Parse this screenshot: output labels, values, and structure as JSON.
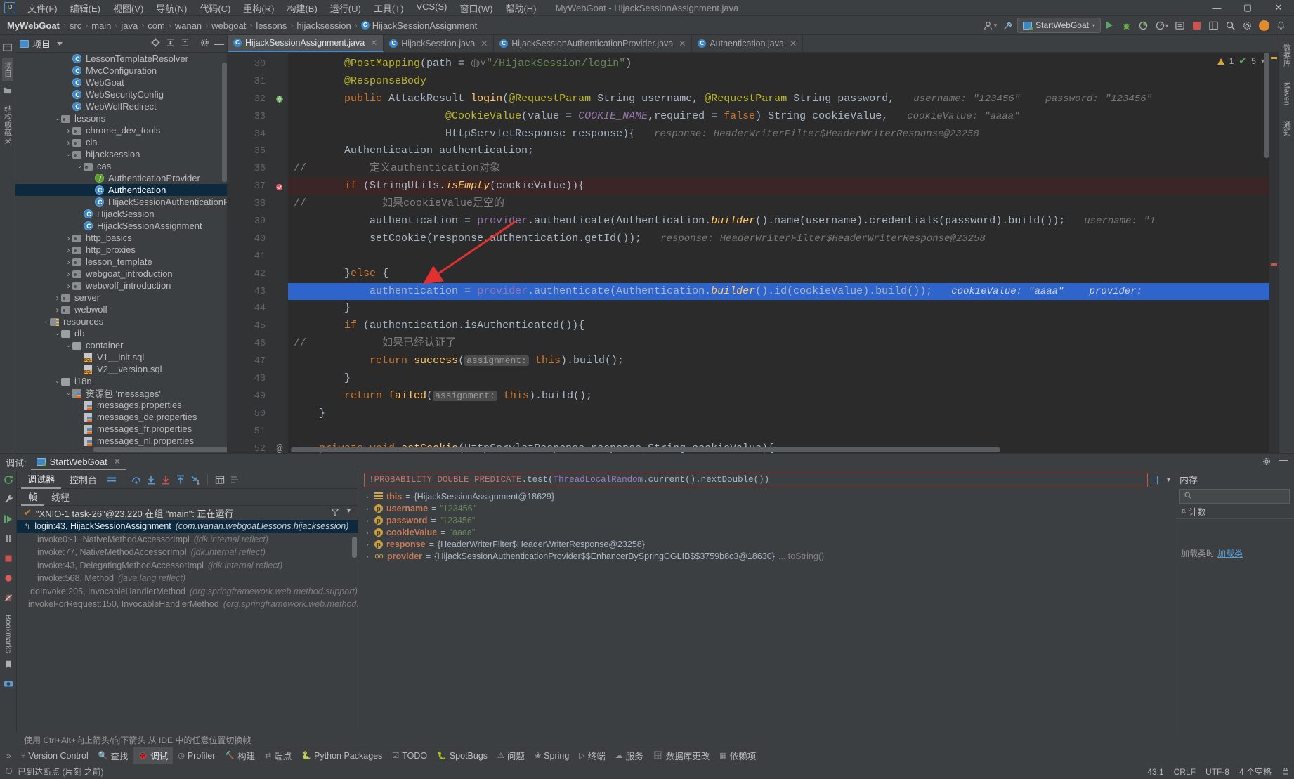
{
  "window": {
    "title": "MyWebGoat - HijackSessionAssignment.java",
    "minimize": "—",
    "maximize": "▢",
    "close": "✕"
  },
  "menubar": {
    "items": [
      "文件(F)",
      "编辑(E)",
      "视图(V)",
      "导航(N)",
      "代码(C)",
      "重构(R)",
      "构建(B)",
      "运行(U)",
      "工具(T)",
      "VCS(S)",
      "窗口(W)",
      "帮助(H)"
    ]
  },
  "breadcrumb": {
    "items": [
      "MyWebGoat",
      "src",
      "main",
      "java",
      "com",
      "wanan",
      "webgoat",
      "lessons",
      "hijacksession",
      "HijackSessionAssignment"
    ],
    "separator": "›"
  },
  "toolbar": {
    "run_config": "StartWebGoat",
    "run_tooltip": "运行",
    "debug_tooltip": "调试",
    "stop_tooltip": "停止",
    "search_tooltip": "搜索",
    "settings_tooltip": "设置",
    "icons": [
      "user-icon",
      "hammer-icon",
      "run-icon",
      "debug-icon",
      "profile-icon",
      "coverage-icon",
      "stop-icon",
      "update-icon",
      "search-icon",
      "settings-icon",
      "account-icon",
      "notification-icon"
    ]
  },
  "left_strip": {
    "labels": [
      "项目",
      "结构收藏夹"
    ]
  },
  "right_strip": {
    "labels": [
      "数据库",
      "Maven",
      "通知"
    ]
  },
  "project_panel": {
    "title": "项目",
    "tree": [
      {
        "indent": 4,
        "arrow": "",
        "icon": "class",
        "label": "LessonTemplateResolver"
      },
      {
        "indent": 4,
        "arrow": "",
        "icon": "class",
        "label": "MvcConfiguration"
      },
      {
        "indent": 4,
        "arrow": "",
        "icon": "class",
        "label": "WebGoat"
      },
      {
        "indent": 4,
        "arrow": "",
        "icon": "class",
        "label": "WebSecurityConfig"
      },
      {
        "indent": 4,
        "arrow": "",
        "icon": "class",
        "label": "WebWolfRedirect"
      },
      {
        "indent": 3,
        "arrow": "v",
        "icon": "pkg",
        "label": "lessons"
      },
      {
        "indent": 4,
        "arrow": ">",
        "icon": "pkg",
        "label": "chrome_dev_tools"
      },
      {
        "indent": 4,
        "arrow": ">",
        "icon": "pkg",
        "label": "cia"
      },
      {
        "indent": 4,
        "arrow": "v",
        "icon": "pkg",
        "label": "hijacksession"
      },
      {
        "indent": 5,
        "arrow": "v",
        "icon": "pkg",
        "label": "cas"
      },
      {
        "indent": 6,
        "arrow": "",
        "icon": "iface",
        "label": "AuthenticationProvider"
      },
      {
        "indent": 6,
        "arrow": "",
        "icon": "class",
        "label": "Authentication",
        "selected": true
      },
      {
        "indent": 6,
        "arrow": "",
        "icon": "class",
        "label": "HijackSessionAuthenticationProvider"
      },
      {
        "indent": 5,
        "arrow": "",
        "icon": "class",
        "label": "HijackSession"
      },
      {
        "indent": 5,
        "arrow": "",
        "icon": "class",
        "label": "HijackSessionAssignment"
      },
      {
        "indent": 4,
        "arrow": ">",
        "icon": "pkg",
        "label": "http_basics"
      },
      {
        "indent": 4,
        "arrow": ">",
        "icon": "pkg",
        "label": "http_proxies"
      },
      {
        "indent": 4,
        "arrow": ">",
        "icon": "pkg",
        "label": "lesson_template"
      },
      {
        "indent": 4,
        "arrow": ">",
        "icon": "pkg",
        "label": "webgoat_introduction"
      },
      {
        "indent": 4,
        "arrow": ">",
        "icon": "pkg",
        "label": "webwolf_introduction"
      },
      {
        "indent": 3,
        "arrow": ">",
        "icon": "pkg",
        "label": "server"
      },
      {
        "indent": 3,
        "arrow": ">",
        "icon": "pkg",
        "label": "webwolf"
      },
      {
        "indent": 2,
        "arrow": "v",
        "icon": "resources",
        "label": "resources"
      },
      {
        "indent": 3,
        "arrow": "v",
        "icon": "folder",
        "label": "db"
      },
      {
        "indent": 4,
        "arrow": "v",
        "icon": "folder",
        "label": "container"
      },
      {
        "indent": 5,
        "arrow": "",
        "icon": "sql",
        "label": "V1__init.sql"
      },
      {
        "indent": 5,
        "arrow": "",
        "icon": "sql",
        "label": "V2__version.sql"
      },
      {
        "indent": 3,
        "arrow": "v",
        "icon": "folder",
        "label": "i18n"
      },
      {
        "indent": 4,
        "arrow": "v",
        "icon": "resbundle",
        "label": "资源包 'messages'"
      },
      {
        "indent": 5,
        "arrow": "",
        "icon": "prop",
        "label": "messages.properties"
      },
      {
        "indent": 5,
        "arrow": "",
        "icon": "prop",
        "label": "messages_de.properties"
      },
      {
        "indent": 5,
        "arrow": "",
        "icon": "prop",
        "label": "messages_fr.properties"
      },
      {
        "indent": 5,
        "arrow": "",
        "icon": "prop",
        "label": "messages_nl.properties"
      }
    ]
  },
  "editor": {
    "tabs": [
      {
        "label": "HijackSessionAssignment.java",
        "active": true
      },
      {
        "label": "HijackSession.java",
        "active": false
      },
      {
        "label": "HijackSessionAuthenticationProvider.java",
        "active": false
      },
      {
        "label": "Authentication.java",
        "active": false
      }
    ],
    "inspection": {
      "warnings": "1",
      "checks": "5"
    },
    "first_line_number": 30,
    "lines": [
      {
        "n": 30,
        "gutter": "",
        "html": "        <span class='anno'>@PostMapping</span><span class='id'>(path = </span><span class='cm'>◍˅</span><span class='str'>\"</span><span class='ulink'>/HijackSession/login</span><span class='str'>\"</span><span class='id'>)</span>"
      },
      {
        "n": 31,
        "gutter": "",
        "html": "        <span class='anno'>@ResponseBody</span>"
      },
      {
        "n": 32,
        "gutter": "globe",
        "html": "        <span class='k'>public</span> <span class='id'>AttackResult</span> <span class='fn'>login</span><span class='id'>(</span><span class='anno'>@RequestParam</span> <span class='id'>String username, </span><span class='anno'>@RequestParam</span> <span class='id'>String password,</span>   <span class='hint'>username:</span> <span class='hint'>\"123456\"</span>    <span class='hint'>password:</span> <span class='hint'>\"123456\"</span>"
      },
      {
        "n": 33,
        "gutter": "",
        "html": "                        <span class='anno'>@CookieValue</span><span class='id'>(value = </span><span class='fld ital'>COOKIE_NAME</span><span class='id'>,required = </span><span class='k'>false</span><span class='id'>) String cookieValue,</span>   <span class='hint'>cookieValue:</span> <span class='hint'>\"aaaa\"</span>"
      },
      {
        "n": 34,
        "gutter": "",
        "html": "                        <span class='id'>HttpServletResponse response){</span>   <span class='hint'>response:</span> <span class='hint'>HeaderWriterFilter$HeaderWriterResponse@23258</span>"
      },
      {
        "n": 35,
        "gutter": "",
        "html": "        <span class='id'>Authentication authentication;</span>"
      },
      {
        "n": 36,
        "gutter": "",
        "comment_col": "//",
        "html": "            <span class='cm'>定义authentication对象</span>"
      },
      {
        "n": 37,
        "gutter": "breakpoint",
        "bp": true,
        "html": "        <span class='k'>if</span> <span class='id'>(StringUtils.</span><span class='fn ital'>isEmpty</span><span class='id'>(cookieValue)){</span>"
      },
      {
        "n": 38,
        "gutter": "",
        "comment_col": "//",
        "html": "              <span class='cm'>如果cookieValue是空的</span>"
      },
      {
        "n": 39,
        "gutter": "",
        "html": "            <span class='id'>authentication = </span><span class='fld'>provider</span><span class='id'>.authenticate(Authentication.</span><span class='fn ital'>builder</span><span class='id'>().name(username).credentials(password).build());</span>   <span class='hint'>username:</span> <span class='hint'>\"1</span>"
      },
      {
        "n": 40,
        "gutter": "",
        "html": "            <span class='id'>setCookie(response,authentication.getId());</span>   <span class='hint'>response:</span> <span class='hint'>HeaderWriterFilter$HeaderWriterResponse@23258</span>"
      },
      {
        "n": 41,
        "gutter": "",
        "html": ""
      },
      {
        "n": 42,
        "gutter": "",
        "html": "        <span class='id'>}</span><span class='k'>else</span> <span class='id'>{</span>"
      },
      {
        "n": 43,
        "gutter": "",
        "current": true,
        "html": "            <span class='id'>authentication = </span><span class='fld'>provider</span><span class='id'>.authenticate(Authentication.</span><span class='fn ital'>builder</span><span class='id'>().id(cookieValue).build());</span>   <span class='hint'>cookieValue:</span> <span class='hint'>\"aaaa\"</span>    <span class='hint'>provider:</span>"
      },
      {
        "n": 44,
        "gutter": "",
        "html": "        <span class='id'>}</span>"
      },
      {
        "n": 45,
        "gutter": "",
        "html": "        <span class='k'>if</span> <span class='id'>(authentication.isAuthenticated()){</span>"
      },
      {
        "n": 46,
        "gutter": "",
        "comment_col": "//",
        "html": "              <span class='cm'>如果已经认证了</span>"
      },
      {
        "n": 47,
        "gutter": "",
        "html": "            <span class='k'>return</span> <span class='fn'>success</span><span class='id'>(</span><span class='hintblk'>assignment:</span> <span class='k'>this</span><span class='id'>).build();</span>"
      },
      {
        "n": 48,
        "gutter": "",
        "html": "        <span class='id'>}</span>"
      },
      {
        "n": 49,
        "gutter": "",
        "html": "        <span class='k'>return</span> <span class='fn'>failed</span><span class='id'>(</span><span class='hintblk'>assignment:</span> <span class='k'>this</span><span class='id'>).build();</span>"
      },
      {
        "n": 50,
        "gutter": "",
        "html": "    <span class='id'>}</span>"
      },
      {
        "n": 51,
        "gutter": "",
        "html": ""
      },
      {
        "n": 52,
        "gutter": "at",
        "html": "    <span class='k'>private</span> <span class='k'>void</span> <span class='fn'>setCookie</span><span class='id'>(HttpServletResponse response,String cookieValue){</span>"
      }
    ]
  },
  "debug": {
    "label": "调试:",
    "session_tab": "StartWebGoat",
    "tabs": [
      "调试器",
      "控制台"
    ],
    "active_tab": "调试器",
    "frame_tabs": [
      "帧",
      "线程"
    ],
    "active_frame_tab": "帧",
    "thread_line": "\"XNIO-1 task-26\"@23,220 在组 \"main\": 正在运行",
    "frames": [
      {
        "text": "login:43, HijackSessionAssignment ",
        "pkg": "(com.wanan.webgoat.lessons.hijacksession)",
        "selected": true
      },
      {
        "text": "invoke0:-1, NativeMethodAccessorImpl ",
        "pkg": "(jdk.internal.reflect)"
      },
      {
        "text": "invoke:77, NativeMethodAccessorImpl ",
        "pkg": "(jdk.internal.reflect)"
      },
      {
        "text": "invoke:43, DelegatingMethodAccessorImpl ",
        "pkg": "(jdk.internal.reflect)"
      },
      {
        "text": "invoke:568, Method ",
        "pkg": "(java.lang.reflect)"
      },
      {
        "text": "doInvoke:205, InvocableHandlerMethod ",
        "pkg": "(org.springframework.web.method.support)"
      },
      {
        "text": "invokeForRequest:150, InvocableHandlerMethod ",
        "pkg": "(org.springframework.web.method.supp"
      }
    ],
    "watch_expression": {
      "prefix": "!",
      "constant": "PROBABILITY_DOUBLE_PREDICATE",
      "mid": ".test(",
      "cls": "ThreadLocalRandom",
      "suffix": ".current().nextDouble())"
    },
    "variables": [
      {
        "icon": "this",
        "name": "this",
        "eq": "=",
        "value": "{HijackSessionAssignment@18629}",
        "kind": "obj"
      },
      {
        "icon": "p",
        "name": "username",
        "eq": "=",
        "value": "\"123456\"",
        "kind": "str"
      },
      {
        "icon": "p",
        "name": "password",
        "eq": "=",
        "value": "\"123456\"",
        "kind": "str"
      },
      {
        "icon": "p",
        "name": "cookieValue",
        "eq": "=",
        "value": "\"aaaa\"",
        "kind": "str"
      },
      {
        "icon": "p",
        "name": "response",
        "eq": "=",
        "value": "{HeaderWriterFilter$HeaderWriterResponse@23258}",
        "kind": "obj"
      },
      {
        "icon": "oo",
        "name": "provider",
        "eq": "=",
        "value": "{HijackSessionAuthenticationProvider$$EnhancerBySpringCGLIB$$3759b8c3@18630}",
        "extra": "... toString()",
        "kind": "obj"
      }
    ],
    "memory": {
      "title": "内存",
      "search_placeholder": "",
      "column": "计数",
      "message": "加载类时",
      "link": "加载类"
    },
    "hint": "使用 Ctrl+Alt+向上箭头/向下箭头 从 IDE 中的任意位置切换帧",
    "vstrip_label": "Bookmarks"
  },
  "bottom_bar": {
    "chevron": "»",
    "items": [
      {
        "label": "Version Control",
        "icon": "branch-icon"
      },
      {
        "label": "查找",
        "icon": "find-icon"
      },
      {
        "label": "调试",
        "icon": "debug-icon",
        "active": true
      },
      {
        "label": "Profiler",
        "icon": "profiler-icon"
      },
      {
        "label": "构建",
        "icon": "build-icon"
      },
      {
        "label": "端点",
        "icon": "endpoints-icon"
      },
      {
        "label": "Python Packages",
        "icon": "python-icon"
      },
      {
        "label": "TODO",
        "icon": "todo-icon"
      },
      {
        "label": "SpotBugs",
        "icon": "spotbugs-icon"
      },
      {
        "label": "问题",
        "icon": "problems-icon"
      },
      {
        "label": "Spring",
        "icon": "spring-icon"
      },
      {
        "label": "终端",
        "icon": "terminal-icon"
      },
      {
        "label": "服务",
        "icon": "services-icon"
      },
      {
        "label": "数据库更改",
        "icon": "db-icon"
      },
      {
        "label": "依赖项",
        "icon": "dependencies-icon"
      }
    ]
  },
  "status_bar": {
    "message": "已到达断点 (片刻 之前)",
    "position": "43:1",
    "line_sep": "CRLF",
    "encoding": "UTF-8",
    "indent": "4 个空格",
    "lock_icon": "lock-icon"
  }
}
